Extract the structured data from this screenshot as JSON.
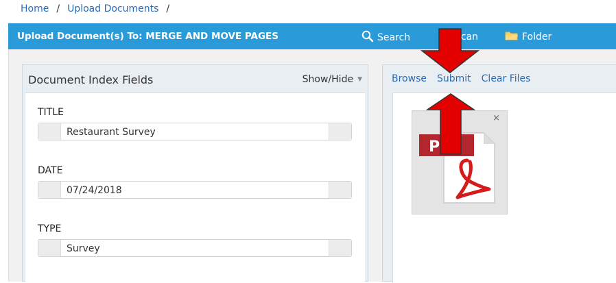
{
  "breadcrumb": {
    "home": "Home",
    "sep1": "/",
    "current": "Upload Documents",
    "sep2": "/"
  },
  "topbar": {
    "title": "Upload Document(s) To:  MERGE AND MOVE PAGES",
    "search_label": "Search",
    "scan_label": "Scan",
    "folder_label": "Folder"
  },
  "index_panel": {
    "title": "Document Index Fields",
    "toggle_label": "Show/Hide",
    "fields": [
      {
        "label": "TITLE",
        "value": "Restaurant Survey"
      },
      {
        "label": "DATE",
        "value": "07/24/2018"
      },
      {
        "label": "TYPE",
        "value": "Survey"
      }
    ]
  },
  "upload_panel": {
    "browse_label": "Browse",
    "submit_label": "Submit",
    "clear_label": "Clear Files",
    "file_badge": "PDF",
    "remove_glyph": "×"
  },
  "colors": {
    "topbar": "#2b9ad9",
    "link": "#2a6db5",
    "arrow": "#e30000",
    "pdf_badge": "#b3262e"
  },
  "icons": [
    "search-icon",
    "scan-icon",
    "folder-icon",
    "caret-down-icon",
    "pdf-file-icon",
    "close-icon",
    "red-arrow-icon"
  ]
}
